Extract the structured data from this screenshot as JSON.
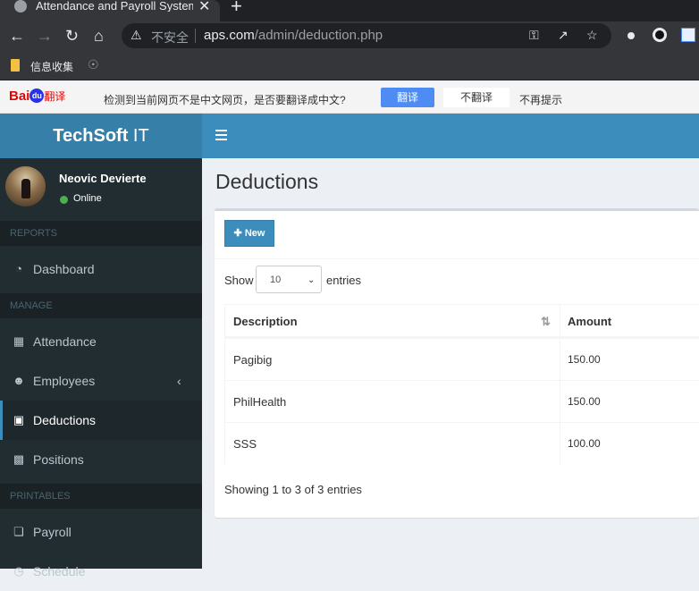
{
  "browser": {
    "tab_title": "Attendance and Payroll System",
    "tab_close": "✕",
    "new_tab": "+",
    "insecure_label": "不安全",
    "url_host": "aps.com",
    "url_path": "/admin/deduction.php",
    "bookmark_label": "信息收集"
  },
  "translate_bar": {
    "logo_text": "Bai",
    "logo_du": "du",
    "logo_suffix": "翻译",
    "message": "检测到当前网页不是中文网页，是否要翻译成中文?",
    "translate_button": "翻译",
    "no_translate_button": "不翻译",
    "never_link": "不再提示"
  },
  "app": {
    "brand_bold": "TechSoft",
    "brand_light": " IT"
  },
  "user": {
    "name": "Neovic Devierte",
    "status": "Online",
    "status_color": "#4caf50"
  },
  "sidebar": {
    "sections": {
      "reports": "REPORTS",
      "manage": "MANAGE",
      "printables": "PRINTABLES"
    },
    "items": {
      "dashboard": "Dashboard",
      "attendance": "Attendance",
      "employees": "Employees",
      "deductions": "Deductions",
      "positions": "Positions",
      "payroll": "Payroll",
      "schedule": "Schedule"
    },
    "active_item": "Deductions"
  },
  "page": {
    "title": "Deductions",
    "new_button": "New",
    "show_label": "Show",
    "entries_value": "10",
    "entries_label": "entries",
    "showing_text": "Showing 1 to 3 of 3 entries"
  },
  "table": {
    "columns": [
      "Description",
      "Amount"
    ],
    "rows": [
      {
        "description": "Pagibig",
        "amount": "150.00"
      },
      {
        "description": "PhilHealth",
        "amount": "150.00"
      },
      {
        "description": "SSS",
        "amount": "100.00"
      }
    ]
  },
  "colors": {
    "header_blue": "#3c8dbc",
    "logo_blue": "#367fa9",
    "sidebar_bg": "#222d32",
    "content_bg": "#ecf0f5"
  }
}
